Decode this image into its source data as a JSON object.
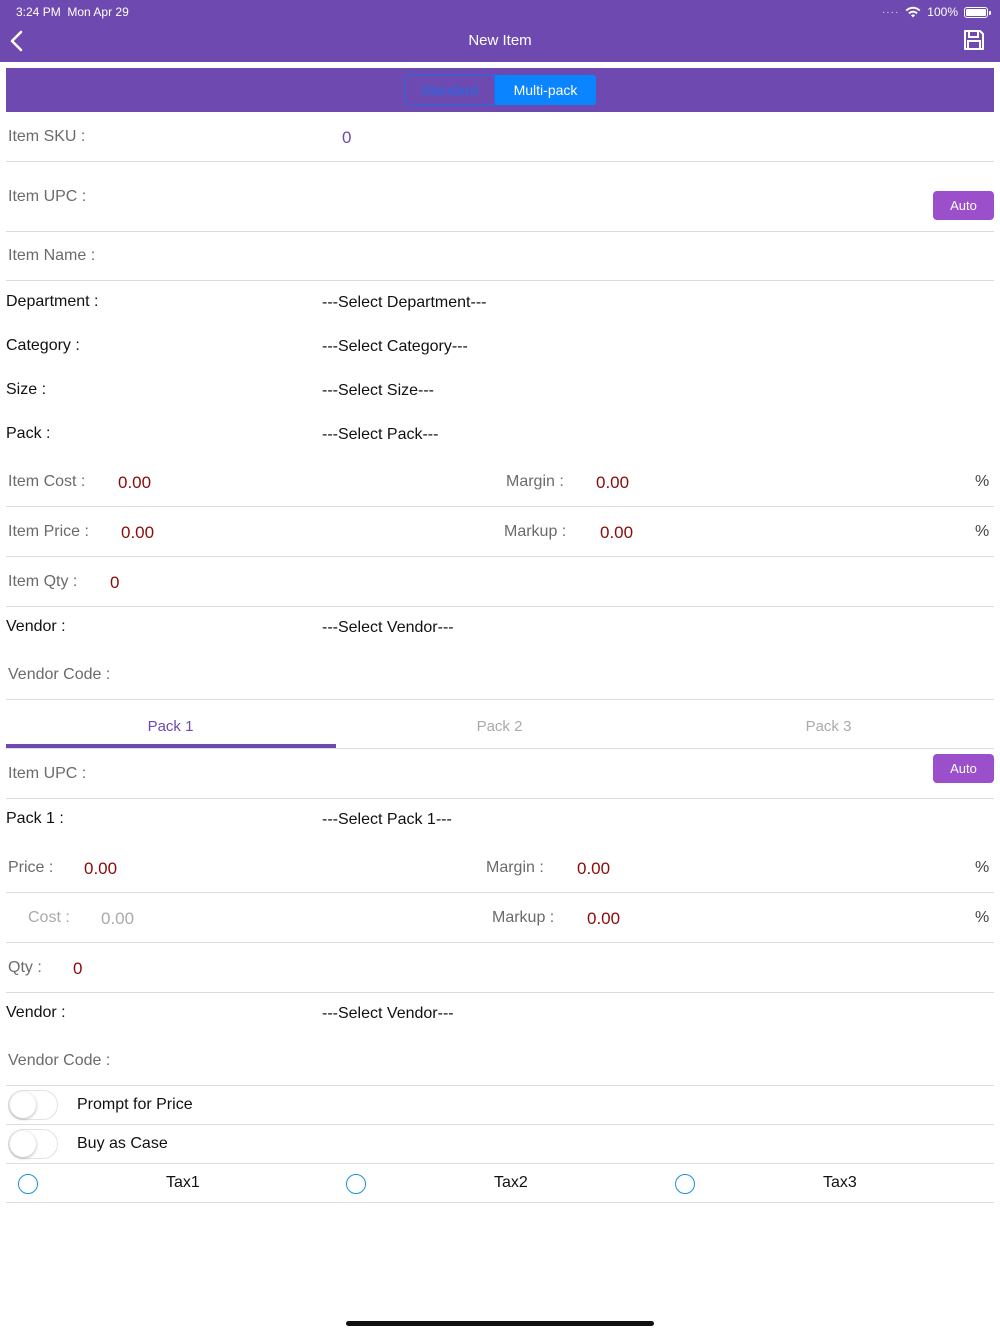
{
  "status_bar": {
    "time": "3:24 PM",
    "date": "Mon Apr 29",
    "battery": "100%"
  },
  "nav": {
    "title": "New Item",
    "back_icon": "chevron-left-icon",
    "save_icon": "floppy-disk-icon"
  },
  "segment": {
    "options": [
      "Standard",
      "Multi-pack"
    ],
    "selected": "Multi-pack"
  },
  "colors": {
    "header": "#6e4ab0",
    "value_red": "#8b0a0a",
    "auto_button": "#9b4fcb",
    "segment_active": "#0a84ff"
  },
  "item": {
    "sku_label": "Item SKU :",
    "sku_value": "0",
    "upc_label": "Item UPC :",
    "auto_label": "Auto",
    "name_label": "Item Name :",
    "department_label": "Department :",
    "department_value": "---Select Department---",
    "category_label": "Category :",
    "category_value": "---Select Category---",
    "size_label": "Size :",
    "size_value": "---Select Size---",
    "pack_label": "Pack :",
    "pack_value": "---Select Pack---",
    "cost_label": "Item Cost :",
    "cost_value": "0.00",
    "margin_label": "Margin :",
    "margin_value": "0.00",
    "price_label": "Item Price :",
    "price_value": "0.00",
    "markup_label": "Markup :",
    "markup_value": "0.00",
    "percent": "%",
    "qty_label": "Item Qty :",
    "qty_value": "0",
    "vendor_label": "Vendor :",
    "vendor_value": "---Select Vendor---",
    "vendor_code_label": "Vendor Code :"
  },
  "pack_tabs": {
    "tabs": [
      "Pack 1",
      "Pack 2",
      "Pack 3"
    ],
    "selected": "Pack 1"
  },
  "pack": {
    "upc_label": "Item UPC :",
    "auto_label": "Auto",
    "pack_label": "Pack 1 :",
    "pack_value": "---Select Pack 1---",
    "price_label": "Price :",
    "price_value": "0.00",
    "margin_label": "Margin :",
    "margin_value": "0.00",
    "cost_label": "Cost :",
    "cost_value": "0.00",
    "markup_label": "Markup :",
    "markup_value": "0.00",
    "percent": "%",
    "qty_label": "Qty :",
    "qty_value": "0",
    "vendor_label": "Vendor :",
    "vendor_value": "---Select Vendor---",
    "vendor_code_label": "Vendor Code :"
  },
  "options": {
    "prompt_price_label": "Prompt for Price",
    "prompt_price_on": false,
    "buy_case_label": "Buy as Case",
    "buy_case_on": false,
    "taxes": [
      "Tax1",
      "Tax2",
      "Tax3"
    ]
  }
}
